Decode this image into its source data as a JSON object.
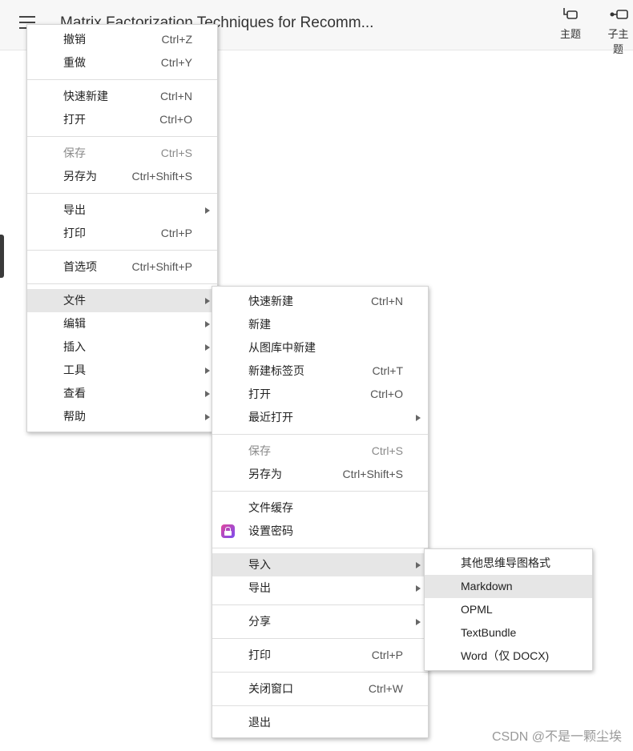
{
  "titlebar": {
    "title": "Matrix Factorization Techniques for Recomm...",
    "topic_label": "主题",
    "subtopic_label": "子主题"
  },
  "main_menu": {
    "items": [
      {
        "label": "撤销",
        "shortcut": "Ctrl+Z"
      },
      {
        "label": "重做",
        "shortcut": "Ctrl+Y"
      },
      {
        "label": "快速新建",
        "shortcut": "Ctrl+N"
      },
      {
        "label": "打开",
        "shortcut": "Ctrl+O"
      },
      {
        "label": "保存",
        "shortcut": "Ctrl+S"
      },
      {
        "label": "另存为",
        "shortcut": "Ctrl+Shift+S"
      },
      {
        "label": "导出"
      },
      {
        "label": "打印",
        "shortcut": "Ctrl+P"
      },
      {
        "label": "首选项",
        "shortcut": "Ctrl+Shift+P"
      },
      {
        "label": "文件"
      },
      {
        "label": "编辑"
      },
      {
        "label": "插入"
      },
      {
        "label": "工具"
      },
      {
        "label": "查看"
      },
      {
        "label": "帮助"
      }
    ]
  },
  "file_menu": {
    "items": [
      {
        "label": "快速新建",
        "shortcut": "Ctrl+N"
      },
      {
        "label": "新建"
      },
      {
        "label": "从图库中新建"
      },
      {
        "label": "新建标签页",
        "shortcut": "Ctrl+T"
      },
      {
        "label": "打开",
        "shortcut": "Ctrl+O"
      },
      {
        "label": "最近打开"
      },
      {
        "label": "保存",
        "shortcut": "Ctrl+S"
      },
      {
        "label": "另存为",
        "shortcut": "Ctrl+Shift+S"
      },
      {
        "label": "文件缓存"
      },
      {
        "label": "设置密码"
      },
      {
        "label": "导入"
      },
      {
        "label": "导出"
      },
      {
        "label": "分享"
      },
      {
        "label": "打印",
        "shortcut": "Ctrl+P"
      },
      {
        "label": "关闭窗口",
        "shortcut": "Ctrl+W"
      },
      {
        "label": "退出"
      }
    ]
  },
  "import_menu": {
    "items": [
      {
        "label": "其他思维导图格式"
      },
      {
        "label": "Markdown"
      },
      {
        "label": "OPML"
      },
      {
        "label": "TextBundle"
      },
      {
        "label": "Word（仅 DOCX)"
      }
    ]
  },
  "watermark": "CSDN @不是一颗尘埃",
  "colors": {
    "highlight": "#e6e6e6",
    "lock_gradient_start": "#e0479e",
    "lock_gradient_end": "#7a4cf0"
  }
}
